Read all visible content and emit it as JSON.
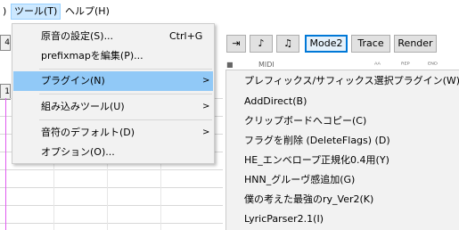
{
  "menubar": {
    "items": [
      {
        "label": ")"
      },
      {
        "label": "ツール(T)"
      },
      {
        "label": "ヘルプ(H)"
      }
    ]
  },
  "left_strip": {
    "cell1": "4",
    "cell2": "1"
  },
  "toolbar": {
    "mode2_label": "Mode2",
    "trace_label": "Trace",
    "render_label": "Render",
    "midi_label": "MIDI",
    "small_labels": [
      "ᴬᴬ",
      "ᴿᴱᴾ",
      "ᴱᴺᴰ"
    ]
  },
  "tools_menu": {
    "items": [
      {
        "label": "原音の設定(S)...",
        "shortcut": "Ctrl+G"
      },
      {
        "label": "prefixmapを編集(P)..."
      },
      {
        "label": "プラグイン(N)",
        "arrow": ">"
      },
      {
        "label": "組み込みツール(U)",
        "arrow": ">"
      },
      {
        "label": "音符のデフォルト(D)",
        "arrow": ">"
      },
      {
        "label": "オプション(O)..."
      }
    ]
  },
  "plugins_submenu": {
    "items": [
      {
        "label": "プレフィックス/サフィックス選択プラグイン(W)"
      },
      {
        "label": "AddDirect(B)"
      },
      {
        "label": "クリップボードへコピー(C)"
      },
      {
        "label": "フラグを削除 (DeleteFlags) (D)"
      },
      {
        "label": "HE_エンベロープ正規化0.4用(Y)"
      },
      {
        "label": "HNN_グルーヴ感追加(G)"
      },
      {
        "label": "僕の考えた最強のry_Ver2(K)"
      },
      {
        "label": "LyricParser2.1(I)"
      }
    ]
  },
  "colors": {
    "menu_bg": "#f2f2f2",
    "highlight": "#91c9f7",
    "menubar_active": "#cce8ff",
    "accent_border": "#0078d7",
    "pink_line": "#e05cf0"
  }
}
